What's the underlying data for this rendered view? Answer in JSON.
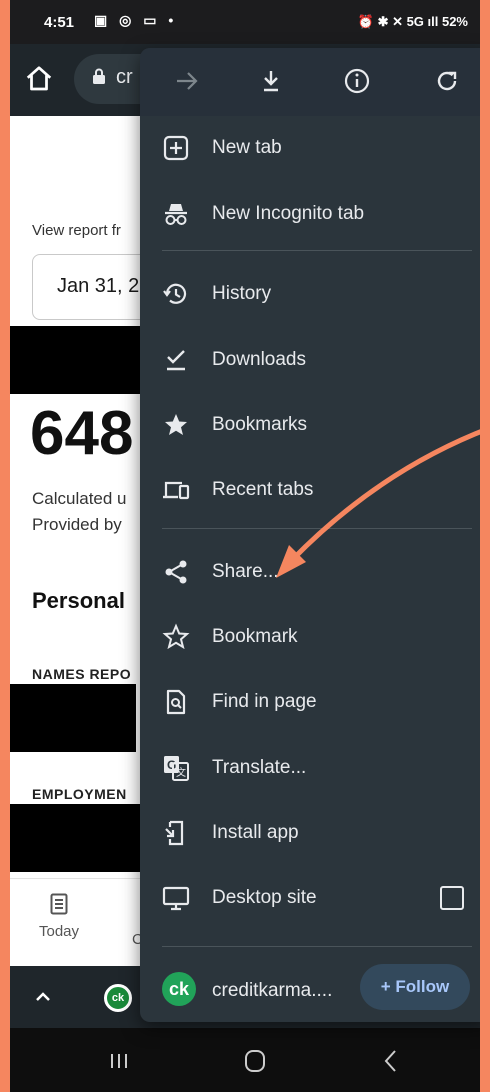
{
  "status_bar": {
    "time": "4:51",
    "left_icons": "▣ ◎ ▭ •",
    "right": "⏰ ✱ ✕ 5G ıll 52%"
  },
  "browser": {
    "url_text": "cr"
  },
  "page": {
    "view_report": "View report fr",
    "date": "Jan 31, 2",
    "score": "648",
    "calc_line1": "Calculated u",
    "calc_line2": "Provided by",
    "section_title": "Personal",
    "names_reported": "NAMES REPO",
    "employment": "EMPLOYMEN",
    "tab_today": "Today",
    "tab_c": "C"
  },
  "menu": {
    "top_buttons": [
      "forward-icon",
      "download-icon",
      "info-icon",
      "refresh-icon"
    ],
    "items": [
      {
        "label": "New tab",
        "icon": "new-tab-icon"
      },
      {
        "label": "New Incognito tab",
        "icon": "incognito-icon"
      },
      {
        "label": "History",
        "icon": "history-icon"
      },
      {
        "label": "Downloads",
        "icon": "downloads-icon"
      },
      {
        "label": "Bookmarks",
        "icon": "star-filled-icon"
      },
      {
        "label": "Recent tabs",
        "icon": "devices-icon"
      },
      {
        "label": "Share...",
        "icon": "share-icon"
      },
      {
        "label": "Bookmark",
        "icon": "star-outline-icon"
      },
      {
        "label": "Find in page",
        "icon": "find-in-page-icon"
      },
      {
        "label": "Translate...",
        "icon": "translate-icon"
      },
      {
        "label": "Install app",
        "icon": "install-app-icon"
      },
      {
        "label": "Desktop site",
        "icon": "desktop-icon"
      }
    ],
    "desktop_site_checked": false,
    "footer": {
      "logo_text": "ck",
      "site": "creditkarma....",
      "follow": "+ Follow"
    }
  },
  "bottom_bar": {
    "tab_badge": "ck"
  },
  "colors": {
    "accent_arrow": "#f5865f",
    "menu_bg": "#2b353c",
    "follow_text": "#a8c7fa"
  }
}
